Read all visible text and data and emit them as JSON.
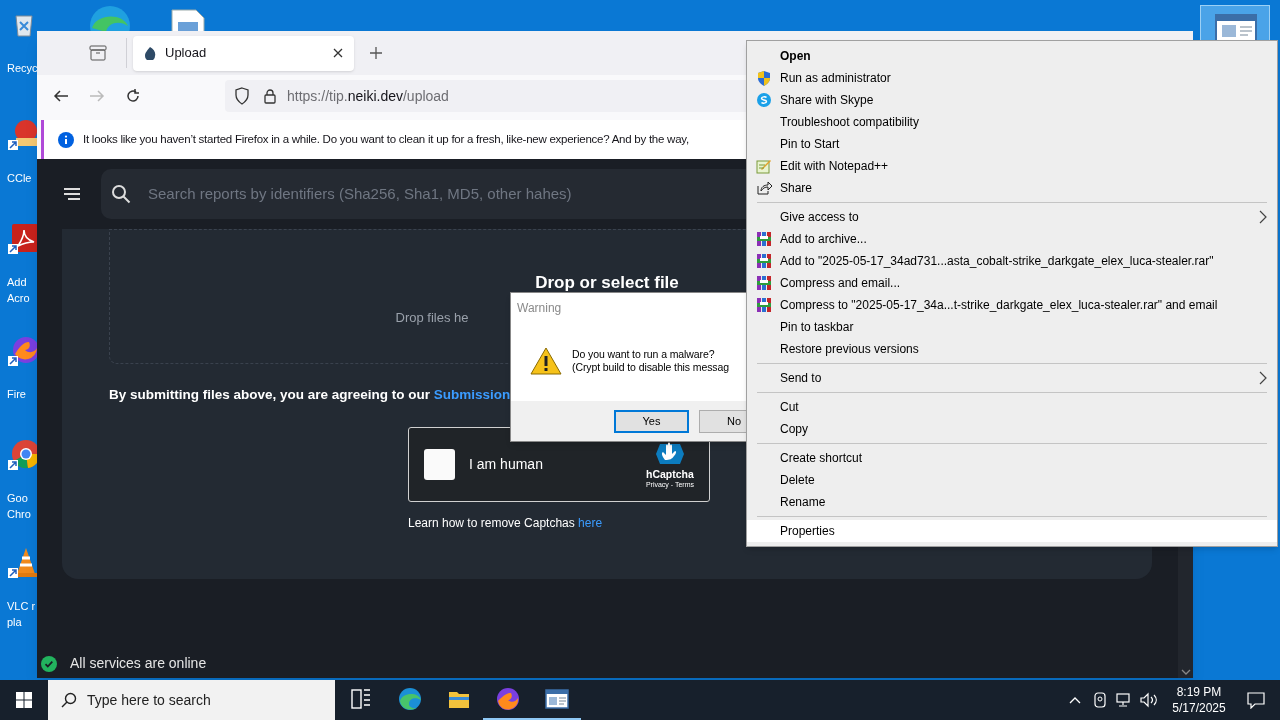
{
  "desktop_icons": [
    {
      "kind": "bin",
      "label": "Recyc"
    },
    {
      "kind": "cleaner",
      "label": "CCle"
    },
    {
      "kind": "pdf",
      "label": "Add\nAcro"
    },
    {
      "kind": "fox",
      "label": "Fire"
    },
    {
      "kind": "chrome",
      "label": "Goo\nChro"
    },
    {
      "kind": "cone",
      "label": "VLC r\npla"
    }
  ],
  "browser": {
    "tab": {
      "title": "Upload",
      "selected": true
    },
    "url": {
      "prefix": "https://tip.",
      "domain": "neiki.dev",
      "path": "/upload"
    },
    "notification": "It looks like you haven’t started Firefox in a while. Do you want to clean it up for a fresh, like-new experience? And by the way,",
    "page": {
      "search_placeholder": "Search reports by identifiers (Sha256, Sha1, MD5, other hahes)",
      "drop_title": "Drop or select file",
      "drop_hint": "Drop files he",
      "terms": {
        "text": "By submitting files above, you are agreeing to our ",
        "link": "Submission"
      },
      "captcha": {
        "label": "I am human",
        "checked": false,
        "brand": "hCaptcha",
        "links": "Privacy - Terms"
      },
      "captcha_help": {
        "text": "Learn how to remove Captchas ",
        "link": "here"
      },
      "status": {
        "text": "All services are online",
        "online": true
      }
    }
  },
  "dialog": {
    "title": "Warning",
    "message": "Do you want to run a malware?\n(Crypt build to disable this messag",
    "buttons": [
      {
        "label": "Yes",
        "focused": true
      },
      {
        "label": "No",
        "focused": false
      }
    ]
  },
  "context_menu": {
    "groups": [
      [
        {
          "label": "Open",
          "kind": "default",
          "selected": false
        },
        {
          "label": "Run as administrator",
          "kind": "shield",
          "selected": false
        },
        {
          "label": "Share with Skype",
          "kind": "skype",
          "selected": false
        },
        {
          "label": "Troubleshoot compatibility",
          "kind": "plain",
          "selected": false
        },
        {
          "label": "Pin to Start",
          "kind": "plain",
          "selected": false
        },
        {
          "label": "Edit with Notepad++",
          "kind": "notepad",
          "selected": false
        },
        {
          "label": "Share",
          "kind": "share",
          "selected": false
        }
      ],
      [
        {
          "label": "Give access to",
          "kind": "submenu",
          "selected": false
        },
        {
          "label": "Add to archive...",
          "kind": "archive",
          "selected": false
        },
        {
          "label": "Add to \"2025-05-17_34ad731...asta_cobalt-strike_darkgate_elex_luca-stealer.rar\"",
          "kind": "archive",
          "selected": false
        },
        {
          "label": "Compress and email...",
          "kind": "archive",
          "selected": false
        },
        {
          "label": "Compress to \"2025-05-17_34a...t-strike_darkgate_elex_luca-stealer.rar\" and email",
          "kind": "archive",
          "selected": false
        },
        {
          "label": "Pin to taskbar",
          "kind": "plain",
          "selected": false
        },
        {
          "label": "Restore previous versions",
          "kind": "plain",
          "selected": false
        }
      ],
      [
        {
          "label": "Send to",
          "kind": "submenu",
          "selected": false
        }
      ],
      [
        {
          "label": "Cut",
          "kind": "plain",
          "selected": false
        },
        {
          "label": "Copy",
          "kind": "plain",
          "selected": false
        }
      ],
      [
        {
          "label": "Create shortcut",
          "kind": "plain",
          "selected": false
        },
        {
          "label": "Delete",
          "kind": "plain",
          "selected": false
        },
        {
          "label": "Rename",
          "kind": "plain",
          "selected": false
        }
      ],
      [
        {
          "label": "Properties",
          "kind": "plain",
          "selected": true
        }
      ]
    ]
  },
  "taskbar": {
    "search_placeholder": "Type here to search",
    "apps": [
      {
        "kind": "taskview",
        "active": false
      },
      {
        "kind": "edge",
        "active": false
      },
      {
        "kind": "folder",
        "active": false
      },
      {
        "kind": "fox",
        "active": true
      },
      {
        "kind": "window",
        "active": true
      }
    ],
    "time": "8:19 PM",
    "date": "5/17/2025"
  }
}
